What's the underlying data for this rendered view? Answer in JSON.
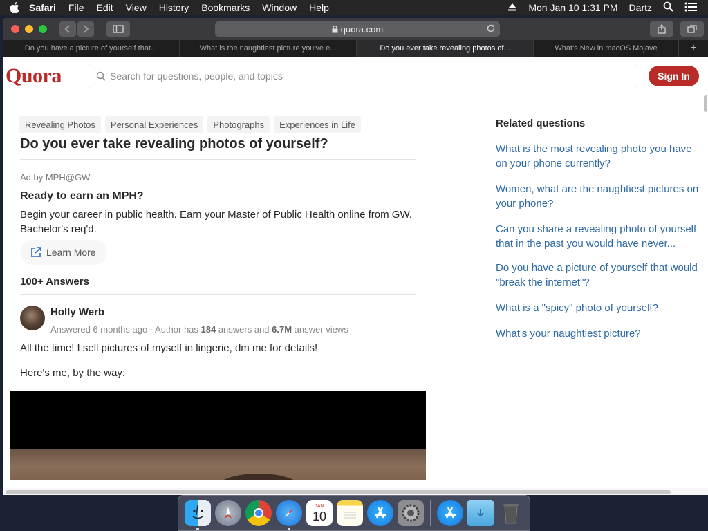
{
  "menubar": {
    "app": "Safari",
    "items": [
      "File",
      "Edit",
      "View",
      "History",
      "Bookmarks",
      "Window",
      "Help"
    ],
    "datetime": "Mon Jan 10  1:31 PM",
    "user": "Dartz"
  },
  "browser": {
    "url": "quora.com",
    "tabs": [
      {
        "title": "Do you have a picture of yourself that..."
      },
      {
        "title": "What is the naughtiest picture you've e..."
      },
      {
        "title": "Do you ever take revealing photos of..."
      },
      {
        "title": "What's New in macOS Mojave"
      }
    ]
  },
  "quora": {
    "logo": "Quora",
    "search_placeholder": "Search for questions, people, and topics",
    "sign_in": "Sign In",
    "topics": [
      "Revealing Photos",
      "Personal Experiences",
      "Photographs",
      "Experiences in Life"
    ],
    "question_title": "Do you ever take revealing photos of yourself?",
    "ad": {
      "by": "Ad by MPH@GW",
      "title": "Ready to earn an MPH?",
      "body": "Begin your career in public health. Earn your Master of Public Health online from GW. Bachelor's req'd.",
      "cta": "Learn More"
    },
    "answers_count": "100+ Answers",
    "answer": {
      "author": "Holly Werb",
      "meta_prefix": "Answered 6 months ago · Author has ",
      "answers_num": "184",
      "meta_mid": " answers and ",
      "views_num": "6.7M",
      "meta_suffix": " answer views",
      "paragraph1": "All the time! I sell pictures of myself in lingerie, dm me for details!",
      "paragraph2": "Here's me, by the way:"
    },
    "related": {
      "heading": "Related questions",
      "questions": [
        "What is the most revealing photo you have on your phone currently?",
        "Women, what are the naughtiest pictures on your phone?",
        "Can you share a revealing photo of yourself that in the past you would have never...",
        "Do you have a picture of yourself that would \"break the internet\"?",
        "What is a \"spicy\" photo of yourself?",
        "What's your naughtiest picture?"
      ]
    }
  },
  "dock": {
    "calendar_day": "10",
    "calendar_month": "JAN"
  },
  "colors": {
    "quora_red": "#b92b27",
    "link_blue": "#2e69a3"
  }
}
